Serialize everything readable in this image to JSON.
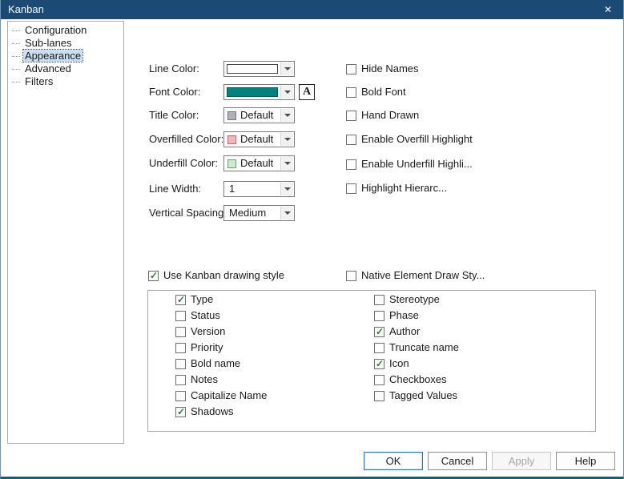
{
  "window": {
    "title": "Kanban",
    "close_glyph": "✕"
  },
  "colors": {
    "titlebar": "#1b4a74",
    "accent": "#2e75b6",
    "bottom_edge": "#00696e",
    "check": "#2e7d32"
  },
  "sidebar": {
    "items": [
      "Configuration",
      "Sub-lanes",
      "Appearance",
      "Advanced",
      "Filters"
    ],
    "selected_index": 2
  },
  "form": {
    "rows": [
      {
        "label": "Line Color:",
        "type": "wide-swatch",
        "swatch": "#ffffff",
        "swatch_border": "#444444"
      },
      {
        "label": "Font Color:",
        "type": "wide-swatch",
        "swatch": "#00837e",
        "swatch_border": "#005a56"
      },
      {
        "label": "Title Color:",
        "type": "swatch-text",
        "value": "Default",
        "swatch": "#b3b0b6",
        "swatch_border": "#77747c"
      },
      {
        "label": "Overfilled Color:",
        "type": "swatch-text",
        "value": "Default",
        "swatch": "#efb9b9",
        "swatch_border": "#c46a6a"
      },
      {
        "label": "Underfill Color:",
        "type": "swatch-text",
        "value": "Default",
        "swatch": "#cfe9cb",
        "swatch_border": "#6f9f6a"
      },
      {
        "label": "Line Width:",
        "type": "text",
        "value": "1"
      },
      {
        "label": "Vertical Spacing:",
        "type": "text",
        "value": "Medium"
      }
    ],
    "font_button_label": "A",
    "option_checks": [
      {
        "label": "Hide Names",
        "checked": false
      },
      {
        "label": "Bold Font",
        "checked": false
      },
      {
        "label": "Hand Drawn",
        "checked": false
      },
      {
        "label": "Enable Overfill Highlight",
        "checked": false
      },
      {
        "label": "Enable Underfill Highli...",
        "checked": false
      },
      {
        "label": "Highlight Hierarc...",
        "checked": false
      }
    ],
    "style_checks": [
      {
        "label": "Use Kanban drawing style",
        "checked": true
      },
      {
        "label": "Native Element Draw Sty...",
        "checked": false
      }
    ],
    "group": {
      "left": [
        {
          "label": "Type",
          "checked": true
        },
        {
          "label": "Status",
          "checked": false
        },
        {
          "label": "Version",
          "checked": false
        },
        {
          "label": "Priority",
          "checked": false
        },
        {
          "label": "Bold name",
          "checked": false
        },
        {
          "label": "Notes",
          "checked": false
        },
        {
          "label": "Capitalize Name",
          "checked": false
        },
        {
          "label": "Shadows",
          "checked": true
        }
      ],
      "right": [
        {
          "label": "Stereotype",
          "checked": false
        },
        {
          "label": "Phase",
          "checked": false
        },
        {
          "label": "Author",
          "checked": true
        },
        {
          "label": "Truncate name",
          "checked": false
        },
        {
          "label": "Icon",
          "checked": true
        },
        {
          "label": "Checkboxes",
          "checked": false
        },
        {
          "label": "Tagged Values",
          "checked": false
        }
      ]
    }
  },
  "buttons": [
    {
      "label": "OK",
      "default": true,
      "enabled": true
    },
    {
      "label": "Cancel",
      "default": false,
      "enabled": true
    },
    {
      "label": "Apply",
      "default": false,
      "enabled": false
    },
    {
      "label": "Help",
      "default": false,
      "enabled": true
    }
  ]
}
